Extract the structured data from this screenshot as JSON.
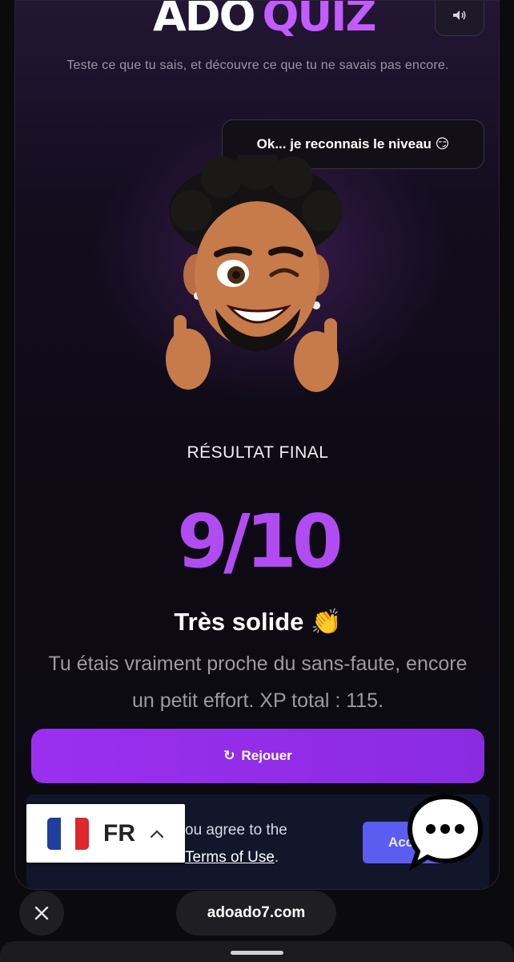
{
  "app": {
    "logo_part1": "ADO",
    "logo_part2": "QUIZ",
    "subtitle": "Teste ce que tu sais, et découvre ce que tu ne savais pas encore.",
    "sound_icon": "speaker-icon"
  },
  "mascot": {
    "speech": "Ok... je reconnais le niveau 😏"
  },
  "result": {
    "label": "RÉSULTAT FINAL",
    "score": "9/10",
    "verdict": "Très solide 👏",
    "description": "Tu étais vraiment proche du sans-faute, encore un petit effort. XP total : 115."
  },
  "actions": {
    "replay_icon": "↻",
    "replay_label": "Rejouer"
  },
  "consent": {
    "text_line1": "ou agree to the",
    "terms_label": "Terms of Use",
    "text_end": ".",
    "accept_label": "Accept"
  },
  "language": {
    "code": "FR"
  },
  "browser": {
    "url": "adoado7.com"
  },
  "colors": {
    "accent": "#b14cf2",
    "button": "#9b2ff0",
    "accept": "#5b5cf0"
  }
}
